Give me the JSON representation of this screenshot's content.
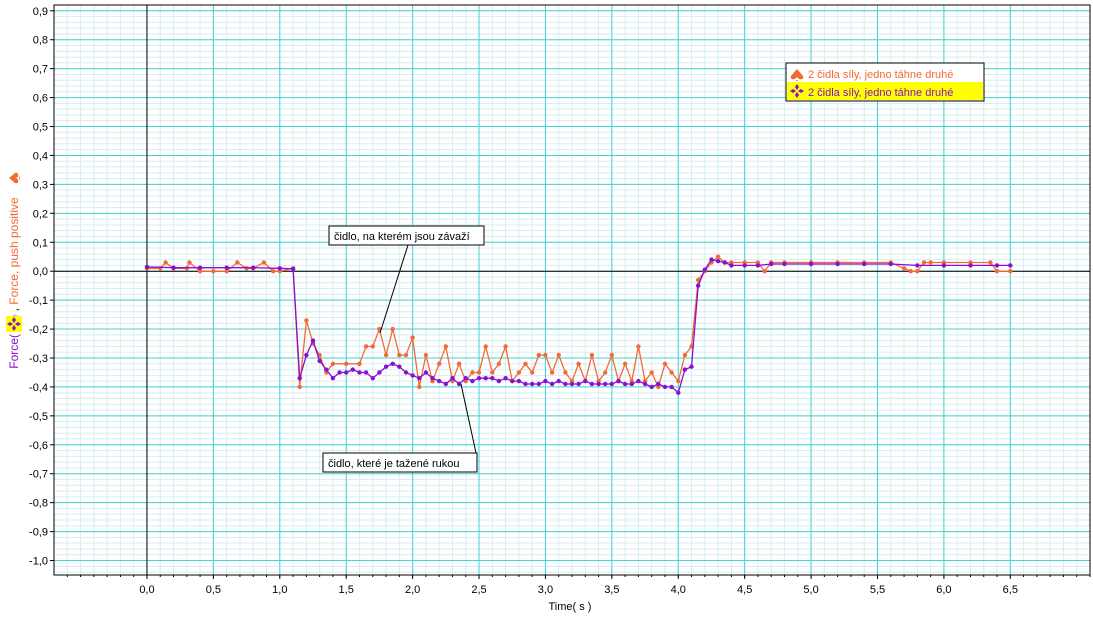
{
  "colors": {
    "background": "#ffffff",
    "major_grid": "#44d2d2",
    "minor_grid": "#d6eef0",
    "series1": "#f26a35",
    "series2": "#8a0fd0",
    "axis": "#000000",
    "legend_highlight": "#ffff00"
  },
  "ylabel": {
    "part1": "Force( N )",
    "part2": "Force, push positive",
    "part1_color": "#8a0fd0",
    "part2_color": "#f26a35"
  },
  "legend": {
    "items": [
      {
        "label": "2 čidla síly, jedno táhne druhé",
        "icon": "spade-icon",
        "color": "#f26a35"
      },
      {
        "label": "2 čidla síly, jedno táhne druhé",
        "icon": "four-diamond-icon",
        "color": "#8a0fd0"
      }
    ]
  },
  "annotations": {
    "a1": "čidlo, na kterém jsou závaží",
    "a2": "čidlo, které je tažené rukou"
  },
  "chart_data": {
    "type": "line",
    "xlabel": "Time( s )",
    "ylabel": "Force( N ) , Force, push positive",
    "xlim": [
      -0.7,
      7.1
    ],
    "ylim": [
      -1.05,
      0.92
    ],
    "x_ticks": [
      "0,0",
      "0,5",
      "1,0",
      "1,5",
      "2,0",
      "2,5",
      "3,0",
      "3,5",
      "4,0",
      "4,5",
      "5,0",
      "5,5",
      "6,0",
      "6,5"
    ],
    "y_ticks": [
      "0,9",
      "0,8",
      "0,7",
      "0,6",
      "0,5",
      "0,4",
      "0,3",
      "0,2",
      "0,1",
      "0,0",
      "-0,1",
      "-0,2",
      "-0,3",
      "-0,4",
      "-0,5",
      "-0,6",
      "-0,7",
      "-0,8",
      "-0,9",
      "-1,0"
    ],
    "grid": true,
    "legend_position": "top-right",
    "series": [
      {
        "name": "2 čidla síly, jedno táhne druhé",
        "color": "#f26a35",
        "marker": "dot",
        "points": [
          [
            0.0,
            0.01
          ],
          [
            0.1,
            0.01
          ],
          [
            0.14,
            0.03
          ],
          [
            0.2,
            0.01
          ],
          [
            0.3,
            0.01
          ],
          [
            0.32,
            0.03
          ],
          [
            0.4,
            0.0
          ],
          [
            0.5,
            0.0
          ],
          [
            0.6,
            0.0
          ],
          [
            0.68,
            0.03
          ],
          [
            0.75,
            0.01
          ],
          [
            0.8,
            0.01
          ],
          [
            0.88,
            0.03
          ],
          [
            0.95,
            0.0
          ],
          [
            1.0,
            0.0
          ],
          [
            1.1,
            0.01
          ],
          [
            1.15,
            -0.4
          ],
          [
            1.2,
            -0.17
          ],
          [
            1.25,
            -0.25
          ],
          [
            1.3,
            -0.29
          ],
          [
            1.35,
            -0.35
          ],
          [
            1.4,
            -0.32
          ],
          [
            1.5,
            -0.32
          ],
          [
            1.6,
            -0.32
          ],
          [
            1.65,
            -0.26
          ],
          [
            1.7,
            -0.26
          ],
          [
            1.75,
            -0.2
          ],
          [
            1.8,
            -0.29
          ],
          [
            1.85,
            -0.2
          ],
          [
            1.9,
            -0.29
          ],
          [
            1.95,
            -0.29
          ],
          [
            2.0,
            -0.23
          ],
          [
            2.05,
            -0.4
          ],
          [
            2.1,
            -0.29
          ],
          [
            2.15,
            -0.38
          ],
          [
            2.2,
            -0.32
          ],
          [
            2.25,
            -0.26
          ],
          [
            2.3,
            -0.38
          ],
          [
            2.35,
            -0.32
          ],
          [
            2.4,
            -0.38
          ],
          [
            2.45,
            -0.35
          ],
          [
            2.5,
            -0.35
          ],
          [
            2.55,
            -0.26
          ],
          [
            2.6,
            -0.35
          ],
          [
            2.65,
            -0.32
          ],
          [
            2.7,
            -0.26
          ],
          [
            2.75,
            -0.38
          ],
          [
            2.8,
            -0.35
          ],
          [
            2.85,
            -0.32
          ],
          [
            2.9,
            -0.35
          ],
          [
            2.95,
            -0.29
          ],
          [
            3.0,
            -0.29
          ],
          [
            3.05,
            -0.35
          ],
          [
            3.1,
            -0.29
          ],
          [
            3.15,
            -0.35
          ],
          [
            3.2,
            -0.38
          ],
          [
            3.25,
            -0.32
          ],
          [
            3.3,
            -0.38
          ],
          [
            3.35,
            -0.29
          ],
          [
            3.4,
            -0.38
          ],
          [
            3.45,
            -0.35
          ],
          [
            3.5,
            -0.29
          ],
          [
            3.55,
            -0.38
          ],
          [
            3.6,
            -0.32
          ],
          [
            3.65,
            -0.38
          ],
          [
            3.7,
            -0.26
          ],
          [
            3.75,
            -0.38
          ],
          [
            3.8,
            -0.35
          ],
          [
            3.85,
            -0.4
          ],
          [
            3.9,
            -0.32
          ],
          [
            3.95,
            -0.35
          ],
          [
            4.0,
            -0.38
          ],
          [
            4.05,
            -0.29
          ],
          [
            4.1,
            -0.26
          ],
          [
            4.15,
            -0.03
          ],
          [
            4.2,
            0.0
          ],
          [
            4.25,
            0.03
          ],
          [
            4.3,
            0.05
          ],
          [
            4.35,
            0.03
          ],
          [
            4.4,
            0.03
          ],
          [
            4.5,
            0.03
          ],
          [
            4.6,
            0.03
          ],
          [
            4.65,
            0.0
          ],
          [
            4.7,
            0.03
          ],
          [
            4.8,
            0.03
          ],
          [
            5.0,
            0.03
          ],
          [
            5.2,
            0.03
          ],
          [
            5.4,
            0.03
          ],
          [
            5.6,
            0.03
          ],
          [
            5.7,
            0.01
          ],
          [
            5.75,
            0.0
          ],
          [
            5.8,
            0.0
          ],
          [
            5.85,
            0.03
          ],
          [
            5.9,
            0.03
          ],
          [
            6.0,
            0.03
          ],
          [
            6.2,
            0.03
          ],
          [
            6.35,
            0.03
          ],
          [
            6.4,
            0.0
          ],
          [
            6.5,
            0.0
          ]
        ]
      },
      {
        "name": "2 čidla síly, jedno táhne druhé",
        "color": "#8a0fd0",
        "marker": "dot",
        "points": [
          [
            0.0,
            0.015
          ],
          [
            0.2,
            0.012
          ],
          [
            0.4,
            0.012
          ],
          [
            0.6,
            0.012
          ],
          [
            0.8,
            0.012
          ],
          [
            1.0,
            0.01
          ],
          [
            1.1,
            0.008
          ],
          [
            1.15,
            -0.37
          ],
          [
            1.2,
            -0.29
          ],
          [
            1.25,
            -0.24
          ],
          [
            1.3,
            -0.31
          ],
          [
            1.35,
            -0.34
          ],
          [
            1.4,
            -0.37
          ],
          [
            1.45,
            -0.35
          ],
          [
            1.5,
            -0.35
          ],
          [
            1.55,
            -0.34
          ],
          [
            1.6,
            -0.35
          ],
          [
            1.65,
            -0.35
          ],
          [
            1.7,
            -0.37
          ],
          [
            1.75,
            -0.35
          ],
          [
            1.8,
            -0.33
          ],
          [
            1.85,
            -0.32
          ],
          [
            1.9,
            -0.33
          ],
          [
            1.95,
            -0.35
          ],
          [
            2.0,
            -0.36
          ],
          [
            2.05,
            -0.37
          ],
          [
            2.1,
            -0.35
          ],
          [
            2.15,
            -0.37
          ],
          [
            2.2,
            -0.38
          ],
          [
            2.25,
            -0.39
          ],
          [
            2.3,
            -0.37
          ],
          [
            2.35,
            -0.39
          ],
          [
            2.4,
            -0.37
          ],
          [
            2.45,
            -0.38
          ],
          [
            2.5,
            -0.37
          ],
          [
            2.55,
            -0.37
          ],
          [
            2.6,
            -0.37
          ],
          [
            2.65,
            -0.38
          ],
          [
            2.7,
            -0.37
          ],
          [
            2.75,
            -0.38
          ],
          [
            2.8,
            -0.38
          ],
          [
            2.85,
            -0.39
          ],
          [
            2.9,
            -0.39
          ],
          [
            2.95,
            -0.39
          ],
          [
            3.0,
            -0.38
          ],
          [
            3.05,
            -0.39
          ],
          [
            3.1,
            -0.38
          ],
          [
            3.15,
            -0.39
          ],
          [
            3.2,
            -0.39
          ],
          [
            3.25,
            -0.39
          ],
          [
            3.3,
            -0.38
          ],
          [
            3.35,
            -0.39
          ],
          [
            3.4,
            -0.39
          ],
          [
            3.45,
            -0.39
          ],
          [
            3.5,
            -0.39
          ],
          [
            3.55,
            -0.38
          ],
          [
            3.6,
            -0.39
          ],
          [
            3.65,
            -0.39
          ],
          [
            3.7,
            -0.38
          ],
          [
            3.75,
            -0.39
          ],
          [
            3.8,
            -0.4
          ],
          [
            3.85,
            -0.39
          ],
          [
            3.9,
            -0.4
          ],
          [
            3.95,
            -0.4
          ],
          [
            4.0,
            -0.42
          ],
          [
            4.05,
            -0.34
          ],
          [
            4.1,
            -0.33
          ],
          [
            4.15,
            -0.05
          ],
          [
            4.2,
            0.005
          ],
          [
            4.25,
            0.04
          ],
          [
            4.3,
            0.035
          ],
          [
            4.35,
            0.03
          ],
          [
            4.4,
            0.02
          ],
          [
            4.5,
            0.02
          ],
          [
            4.6,
            0.02
          ],
          [
            4.7,
            0.025
          ],
          [
            4.8,
            0.025
          ],
          [
            5.0,
            0.025
          ],
          [
            5.2,
            0.025
          ],
          [
            5.4,
            0.025
          ],
          [
            5.6,
            0.025
          ],
          [
            5.8,
            0.02
          ],
          [
            6.0,
            0.02
          ],
          [
            6.2,
            0.02
          ],
          [
            6.4,
            0.02
          ],
          [
            6.5,
            0.02
          ]
        ]
      }
    ]
  }
}
